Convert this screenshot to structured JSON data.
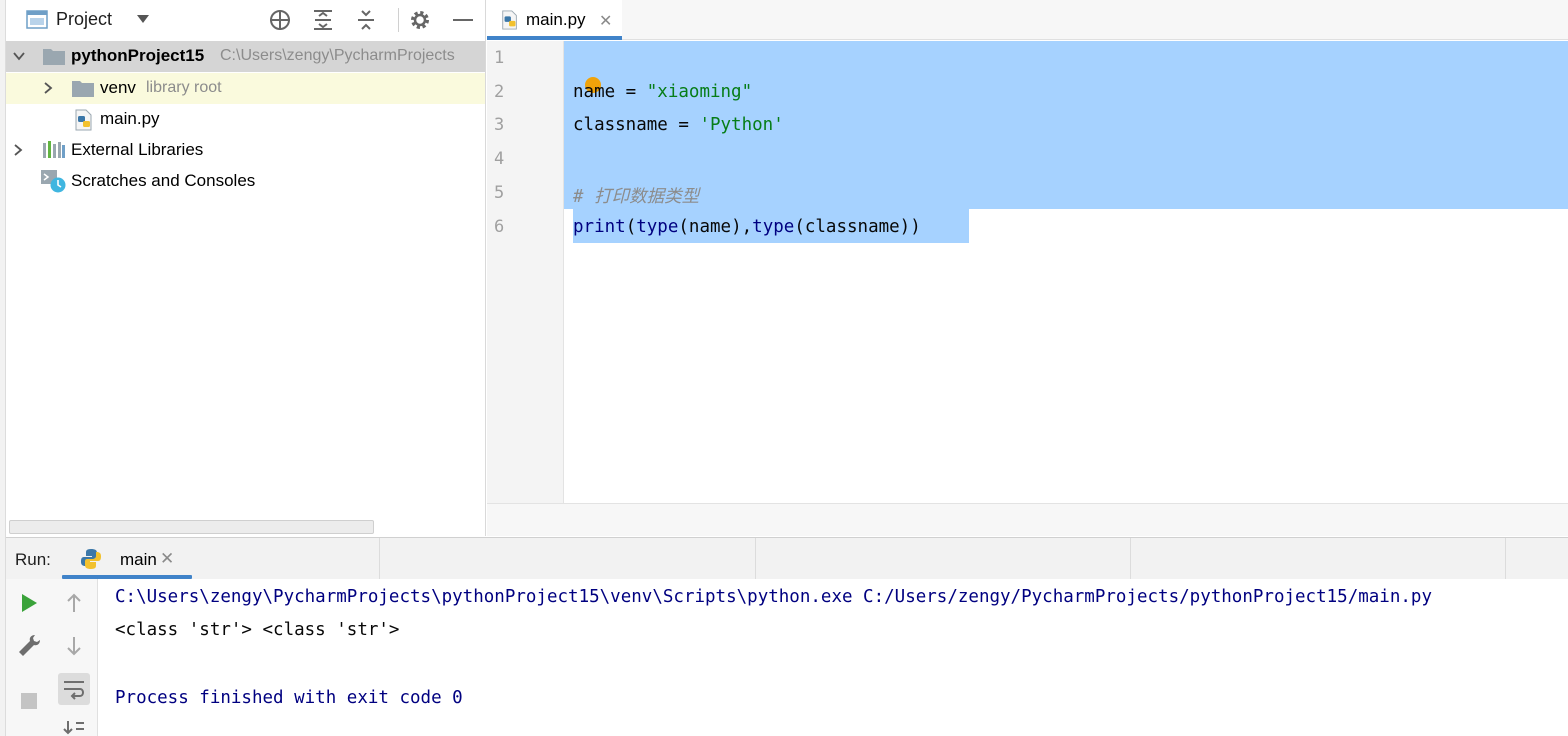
{
  "project_panel": {
    "title": "Project",
    "tree": {
      "root_name": "pythonProject15",
      "root_path": "C:\\Users\\zengy\\PycharmProjects",
      "venv_name": "venv",
      "venv_hint": "library root",
      "main_file": "main.py",
      "external_libraries": "External Libraries",
      "scratches": "Scratches and Consoles"
    }
  },
  "editor": {
    "tab_label": "main.py",
    "tab_close": "✕",
    "line_numbers": [
      "1",
      "2",
      "3",
      "4",
      "5",
      "6"
    ],
    "code": {
      "line2_var": "name = ",
      "line2_str": "\"xiaoming\"",
      "line3_var": "classname = ",
      "line3_str": "'Python'",
      "line5_comment": "# 打印数据类型",
      "line6_print": "print",
      "line6_p1": "(",
      "line6_type1": "type",
      "line6_mid": "(name),",
      "line6_type2": "type",
      "line6_end": "(classname))"
    }
  },
  "run_panel": {
    "label": "Run:",
    "tab_label": "main",
    "tab_close": "✕",
    "output": {
      "command": "C:\\Users\\zengy\\PycharmProjects\\pythonProject15\\venv\\Scripts\\python.exe C:/Users/zengy/PycharmProjects/pythonProject15/main.py",
      "result": "<class 'str'> <class 'str'>",
      "exit": "Process finished with exit code 0"
    }
  },
  "colors": {
    "selection": "#a6d2ff",
    "string": "#067d17",
    "builtin": "#000080",
    "comment": "#8c8c8c",
    "accent": "#4083c9",
    "run_green": "#3aa33a"
  },
  "icons": [
    "project-view-icon",
    "dropdown-caret-icon",
    "locate-icon",
    "expand-all-icon",
    "collapse-all-icon",
    "gear-icon",
    "hide-icon",
    "folder-icon",
    "python-file-icon",
    "libraries-icon",
    "scratches-icon",
    "chevron-right-icon",
    "chevron-down-icon",
    "close-icon",
    "run-icon",
    "wrench-icon",
    "stop-icon",
    "arrow-up-icon",
    "arrow-down-icon",
    "soft-wrap-icon",
    "scroll-to-end-icon"
  ]
}
